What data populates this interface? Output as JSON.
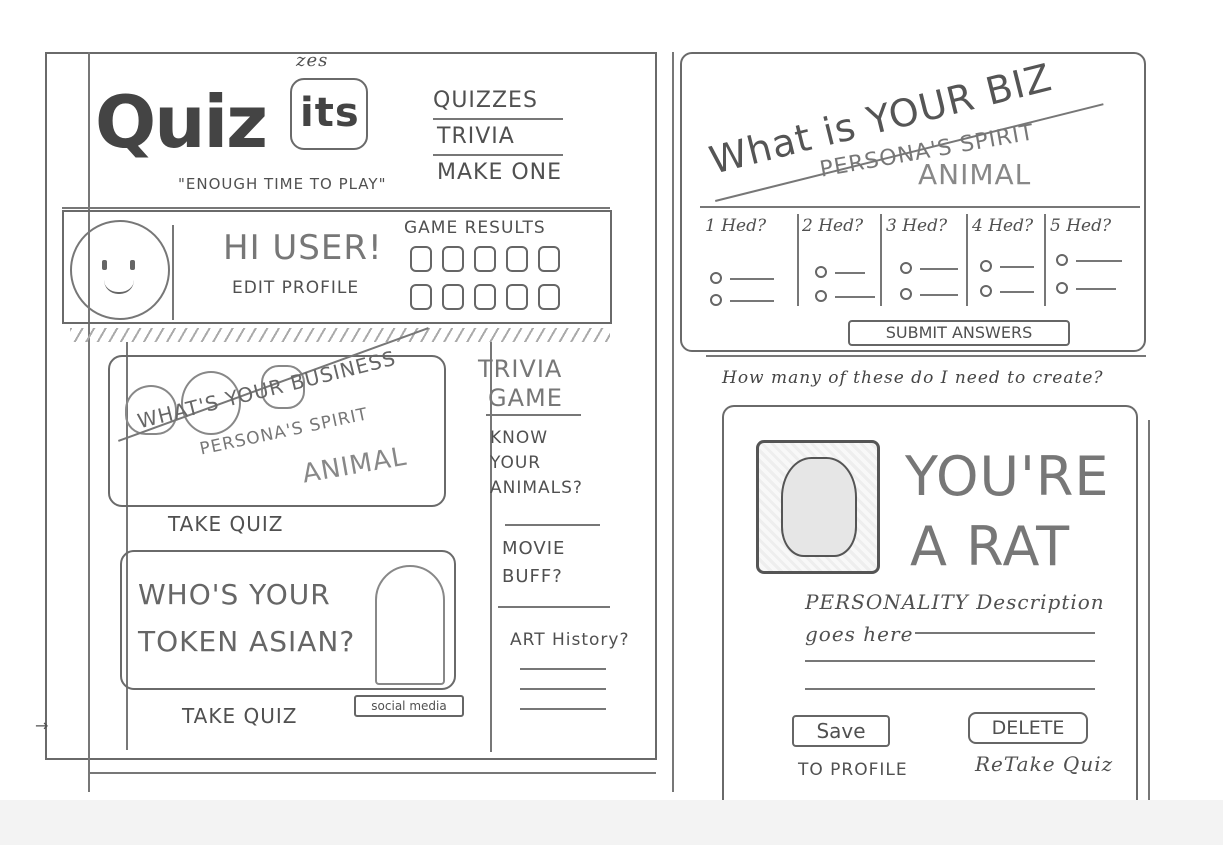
{
  "logo": {
    "quiz": "Quiz",
    "its": "its",
    "zes": "zes",
    "tagline": "\"ENOUGH TIME TO PLAY\""
  },
  "nav": {
    "items": [
      "QUIZZES",
      "TRIVIA",
      "MAKE ONE"
    ]
  },
  "profile": {
    "greeting": "HI USER!",
    "edit_profile": "EDIT PROFILE",
    "game_results_title": "GAME RESULTS"
  },
  "quiz_cards": [
    {
      "line1": "WHAT'S YOUR BUSINESS",
      "line2": "PERSONA'S SPIRIT",
      "line3": "ANIMAL",
      "cta": "TAKE QUIZ"
    },
    {
      "line1": "WHO'S YOUR",
      "line2": "TOKEN ASIAN?",
      "cta": "TAKE QUIZ",
      "share": "social media"
    }
  ],
  "trivia": {
    "title_line1": "TRIVIA",
    "title_line2": "GAME",
    "items": [
      {
        "line1": "KNOW",
        "line2": "YOUR",
        "line3": "ANIMALS?"
      },
      {
        "line1": "MOVIE",
        "line2": "BUFF?"
      },
      {
        "line1": "ART History?"
      }
    ]
  },
  "quiz_page": {
    "title": "What is YOUR BIZ",
    "subtitle": "PERSONA'S SPIRIT",
    "subtitle2": "ANIMAL",
    "questions": [
      "1 Hed?",
      "2 Hed?",
      "3 Hed?",
      "4 Hed?",
      "5 Hed?"
    ],
    "submit": "SUBMIT ANSWERS"
  },
  "note": "How many of these do I need to create?",
  "result_page": {
    "line1": "YOU'RE",
    "line2": "A RAT",
    "desc_line1": "PERSONALITY Description",
    "desc_line2": "goes here",
    "save": "Save",
    "save_sub": "TO PROFILE",
    "delete": "DELETE",
    "delete_sub": "ReTake Quiz"
  }
}
